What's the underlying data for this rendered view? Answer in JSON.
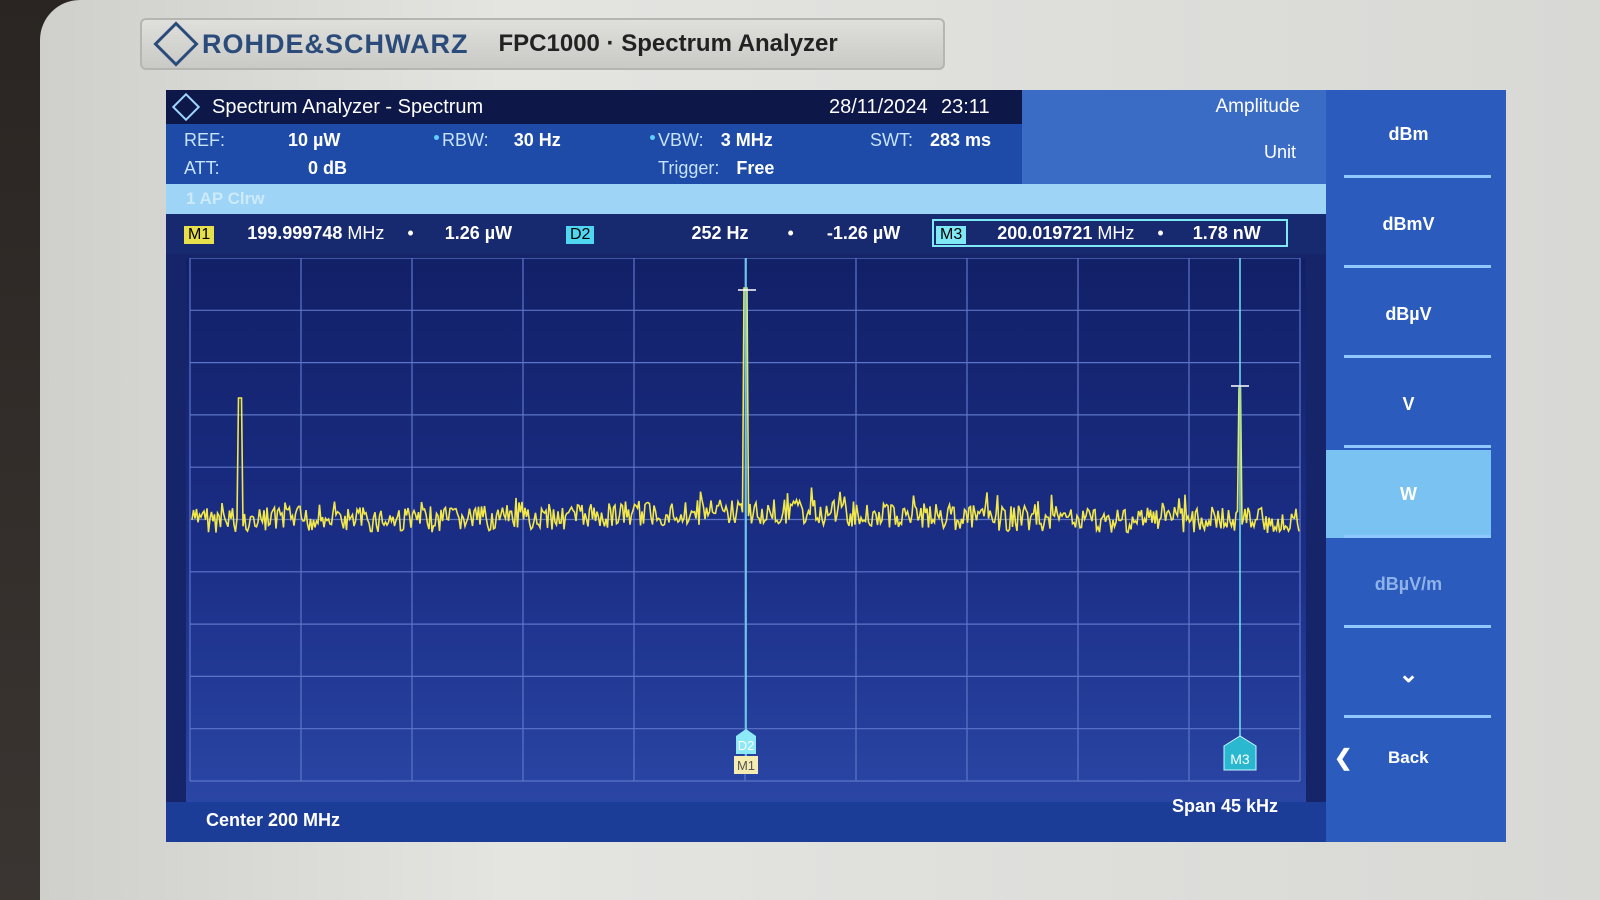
{
  "brand": {
    "logo_text": "ROHDE&SCHWARZ",
    "model": "FPC1000 · Spectrum Analyzer"
  },
  "titlebar": {
    "title": "Spectrum Analyzer - Spectrum",
    "date": "28/11/2024",
    "time": "23:11"
  },
  "params": {
    "ref_label": "REF:",
    "ref_value": "10 µW",
    "att_label": "ATT:",
    "att_value": "0 dB",
    "rbw_label": "RBW:",
    "rbw_value": "30 Hz",
    "vbw_label": "VBW:",
    "vbw_value": "3 MHz",
    "trigger_label": "Trigger:",
    "trigger_value": "Free",
    "swt_label": "SWT:",
    "swt_value": "283 ms"
  },
  "panel": {
    "title": "Amplitude",
    "subtitle": "Unit"
  },
  "trace": {
    "label": "1 AP Clrw"
  },
  "markers": {
    "m1": {
      "tag": "M1",
      "freq": "199.999748",
      "freq_unit": "MHz",
      "level": "1.26 µW"
    },
    "d2": {
      "tag": "D2",
      "delta": "252 Hz",
      "level": "-1.26 µW"
    },
    "m3": {
      "tag": "M3",
      "freq": "200.019721",
      "freq_unit": "MHz",
      "level": "1.78 nW"
    }
  },
  "bottom": {
    "center": "Center 200 MHz",
    "span": "Span 45 kHz"
  },
  "softkeys": [
    "dBm",
    "dBmV",
    "dBµV",
    "V",
    "W",
    "dBµV/m"
  ],
  "softkey_active": "W",
  "softkey_disabled": "dBµV/m",
  "back_label": "Back",
  "colors": {
    "trace": "#f2e84a",
    "marker_line": "#6fe3f0",
    "grid": "#5d75c8"
  }
}
